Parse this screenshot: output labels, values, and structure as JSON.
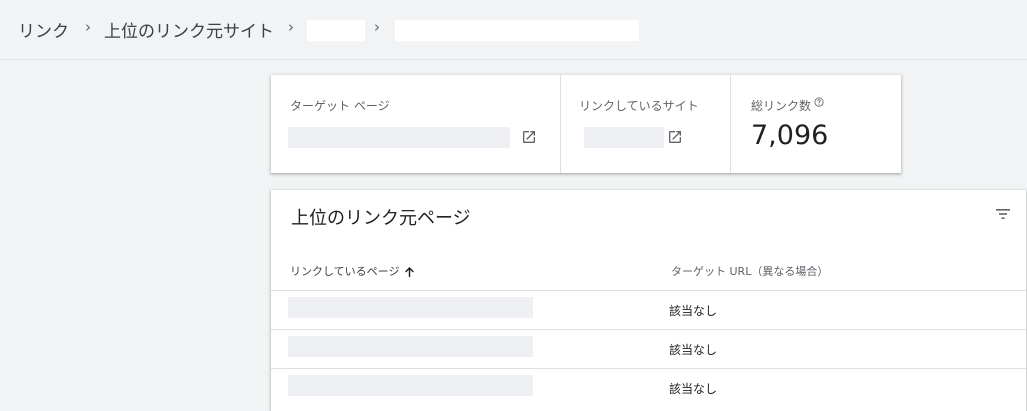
{
  "breadcrumb": {
    "items": [
      "リンク",
      "上位のリンク元サイト"
    ],
    "separator": "›"
  },
  "summary": {
    "target_page_label": "ターゲット ページ",
    "linking_sites_label": "リンクしているサイト",
    "total_links_label": "総リンク数",
    "total_links_value": "7,096"
  },
  "top_pages": {
    "title": "上位のリンク元ページ",
    "columns": {
      "linking_page": "リンクしているページ",
      "target_url": "ターゲット URL（異なる場合）"
    },
    "rows": [
      {
        "target": "該当なし"
      },
      {
        "target": "該当なし"
      },
      {
        "target": "該当なし"
      }
    ]
  },
  "icons": [
    "open-in-new-icon",
    "help-icon",
    "filter-icon",
    "sort-ascending-icon"
  ],
  "colors": {
    "page_bg": "#f1f3f4",
    "card_bg": "#ffffff",
    "text": "#202124",
    "muted": "#5f6368",
    "placeholder": "#eef0f3"
  }
}
